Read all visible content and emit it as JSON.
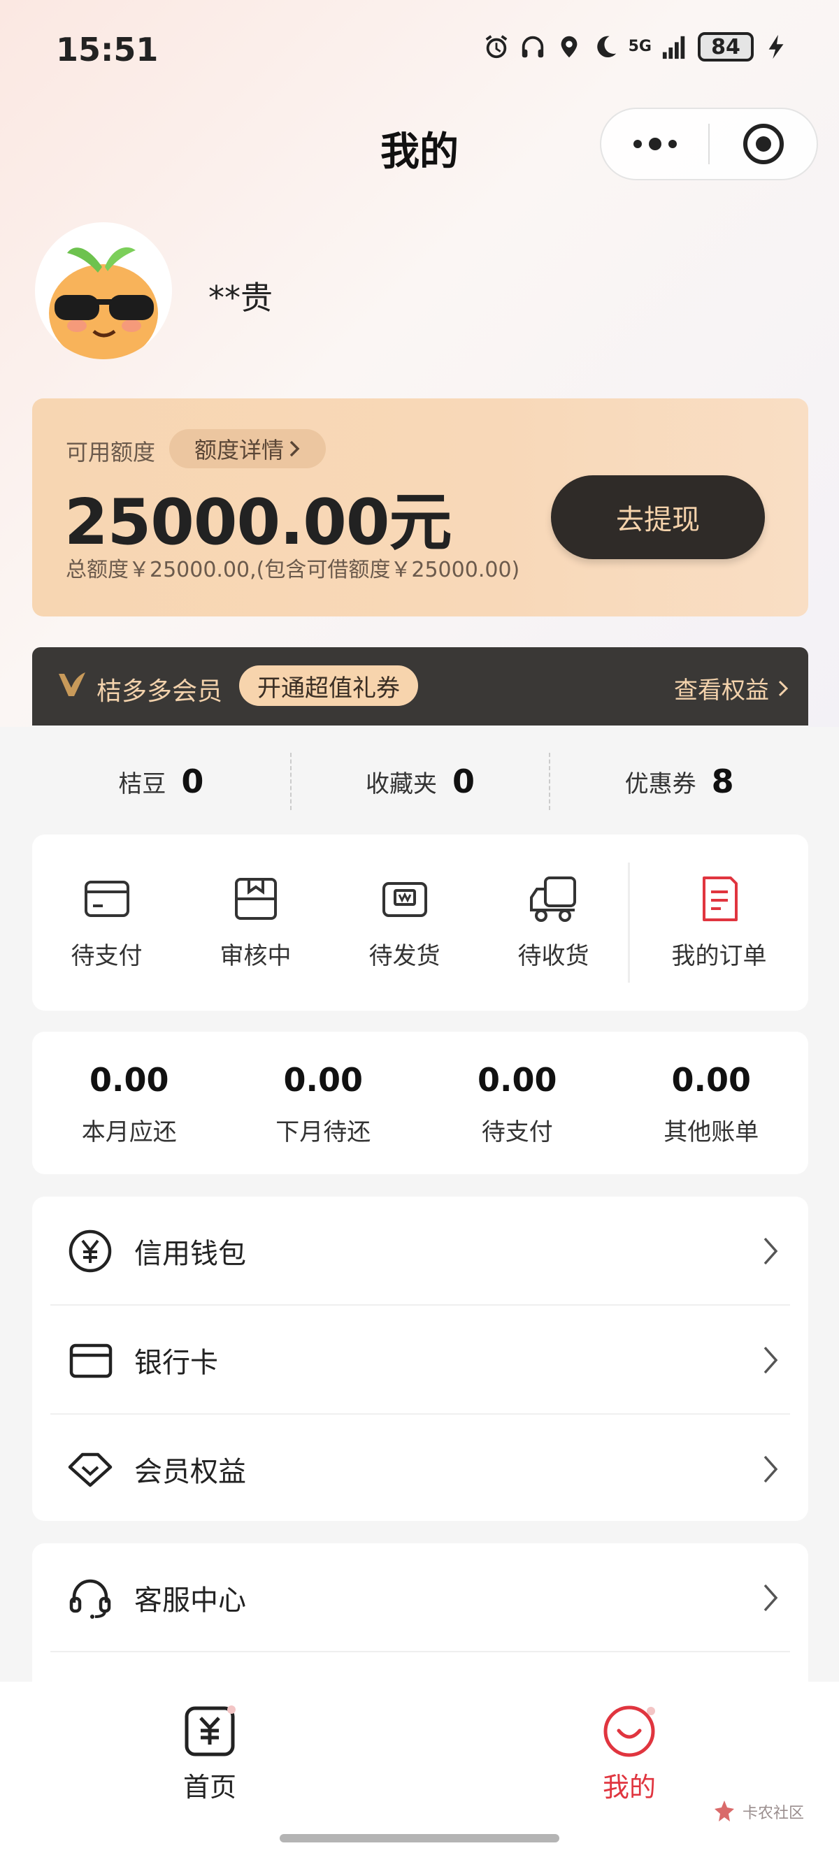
{
  "status_bar": {
    "time": "15:51",
    "network": "5G",
    "battery": "84"
  },
  "nav": {
    "title": "我的"
  },
  "profile": {
    "username": "**贵"
  },
  "credit": {
    "available_label": "可用额度",
    "detail_link": "额度详情",
    "amount": "25000.00元",
    "total_text": "总额度￥25000.00,(包含可借额度￥25000.00)",
    "withdraw_button": "去提现"
  },
  "member": {
    "title": "桔多多会员",
    "promo": "开通超值礼券",
    "link": "查看权益"
  },
  "stats": [
    {
      "label": "桔豆",
      "value": "0"
    },
    {
      "label": "收藏夹",
      "value": "0"
    },
    {
      "label": "优惠券",
      "value": "8"
    }
  ],
  "orders": [
    {
      "label": "待支付",
      "icon": "card-icon"
    },
    {
      "label": "审核中",
      "icon": "review-box-icon"
    },
    {
      "label": "待发货",
      "icon": "package-icon"
    },
    {
      "label": "待收货",
      "icon": "truck-icon"
    }
  ],
  "orders_main": {
    "label": "我的订单",
    "icon": "order-list-icon",
    "color": "#e0353f"
  },
  "bills": [
    {
      "value": "0.00",
      "label": "本月应还"
    },
    {
      "value": "0.00",
      "label": "下月待还"
    },
    {
      "value": "0.00",
      "label": "待支付"
    },
    {
      "value": "0.00",
      "label": "其他账单"
    }
  ],
  "menu": [
    {
      "label": "信用钱包",
      "icon": "yuan-coin-icon"
    },
    {
      "label": "银行卡",
      "icon": "bank-card-icon"
    },
    {
      "label": "会员权益",
      "icon": "diamond-icon"
    },
    {
      "label": "客服中心",
      "icon": "headset-icon"
    }
  ],
  "tabs": [
    {
      "label": "首页",
      "icon": "home-tab-icon",
      "active": false
    },
    {
      "label": "我的",
      "icon": "mine-tab-icon",
      "active": true
    }
  ],
  "watermark": {
    "text": "卡农社区"
  },
  "colors": {
    "accent": "#e0353f",
    "card_bg": "#f7d6b2",
    "dark": "#2f2b28",
    "gold_text": "#f3d2ac"
  }
}
